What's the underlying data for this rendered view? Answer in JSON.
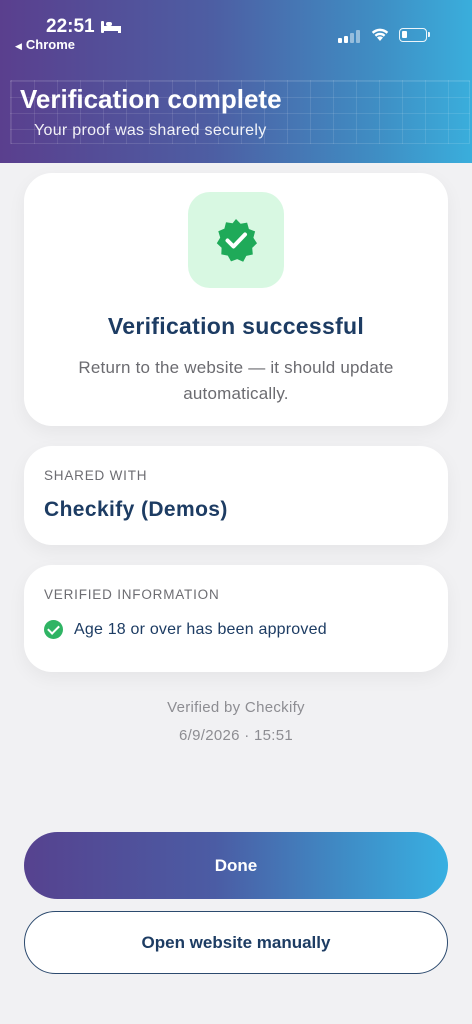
{
  "status_bar": {
    "time": "22:51",
    "back_app": "Chrome"
  },
  "header": {
    "title": "Verification complete",
    "subtitle": "Your proof was shared securely"
  },
  "success_card": {
    "icon": "verified-badge-icon",
    "title": "Verification successful",
    "text": "Return to the website — it should update automatically."
  },
  "shared_with": {
    "label": "SHARED WITH",
    "value": "Checkify (Demos)"
  },
  "verified_information": {
    "label": "VERIFIED INFORMATION",
    "items": [
      {
        "text": "Age 18 or over has been approved",
        "icon": "check-circle-icon"
      }
    ]
  },
  "footer": {
    "verified_by": "Verified by Checkify",
    "timestamp": "6/9/2026 · 15:51"
  },
  "buttons": {
    "done": "Done",
    "open_website": "Open website manually"
  },
  "colors": {
    "accent_purple": "#56428f",
    "accent_blue": "#38b0e2",
    "navy_text": "#1d3c63",
    "success_green": "#2fb464",
    "success_tile": "#d8f8e2"
  }
}
